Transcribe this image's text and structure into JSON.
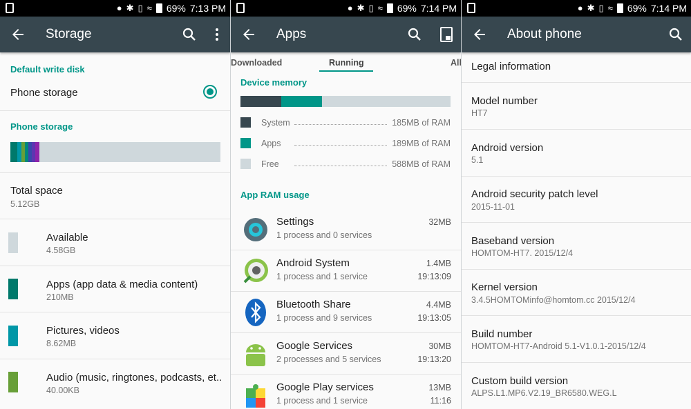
{
  "status_bars": [
    {
      "battery": "69%",
      "time": "7:13 PM"
    },
    {
      "battery": "69%",
      "time": "7:14 PM"
    },
    {
      "battery": "69%",
      "time": "7:14 PM"
    }
  ],
  "storage": {
    "title": "Storage",
    "default_write_disk_header": "Default write disk",
    "phone_storage_option": "Phone storage",
    "phone_storage_header": "Phone storage",
    "total_space": {
      "label": "Total space",
      "value": "5.12GB"
    },
    "items": [
      {
        "label": "Available",
        "value": "4.58GB",
        "color": "#cfd8dc"
      },
      {
        "label": "Apps (app data & media content)",
        "value": "210MB",
        "color": "#00796b"
      },
      {
        "label": "Pictures, videos",
        "value": "8.62MB",
        "color": "#0097a7"
      },
      {
        "label": "Audio (music, ringtones, podcasts, et..",
        "value": "40.00KB",
        "color": "#689f38"
      }
    ]
  },
  "apps": {
    "title": "Apps",
    "tabs": [
      "Downloaded",
      "Running",
      "All"
    ],
    "device_memory_header": "Device memory",
    "memory_rows": [
      {
        "label": "System",
        "value": "185MB of RAM",
        "color": "#37474f"
      },
      {
        "label": "Apps",
        "value": "189MB of RAM",
        "color": "#009688"
      },
      {
        "label": "Free",
        "value": "588MB of RAM",
        "color": "#cfd8dc"
      }
    ],
    "app_ram_header": "App RAM usage",
    "running_apps": [
      {
        "name": "Settings",
        "sub": "1 process and 0 services",
        "size": "32MB",
        "time": ""
      },
      {
        "name": "Android System",
        "sub": "1 process and 1 service",
        "size": "1.4MB",
        "time": "19:13:09"
      },
      {
        "name": "Bluetooth Share",
        "sub": "1 process and 9 services",
        "size": "4.4MB",
        "time": "19:13:05"
      },
      {
        "name": "Google Services",
        "sub": "2 processes and 5 services",
        "size": "30MB",
        "time": "19:13:20"
      },
      {
        "name": "Google Play services",
        "sub": "1 process and 1 service",
        "size": "13MB",
        "time": "11:16"
      }
    ]
  },
  "about": {
    "title": "About phone",
    "rows": [
      {
        "label": "Legal information",
        "value": ""
      },
      {
        "label": "Model number",
        "value": "HT7"
      },
      {
        "label": "Android version",
        "value": "5.1"
      },
      {
        "label": "Android security patch level",
        "value": "2015-11-01"
      },
      {
        "label": "Baseband version",
        "value": "HOMTOM-HT7. 2015/12/4"
      },
      {
        "label": "Kernel version",
        "value": "3.4.5HOMTOMinfo@homtom.cc 2015/12/4"
      },
      {
        "label": "Build number",
        "value": "HOMTOM-HT7-Android 5.1-V1.0.1-2015/12/4"
      },
      {
        "label": "Custom build version",
        "value": "ALPS.L1.MP6.V2.19_BR6580.WEG.L"
      }
    ]
  }
}
